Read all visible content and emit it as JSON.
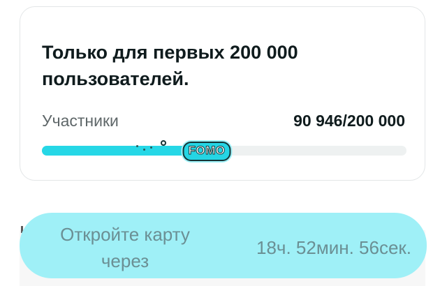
{
  "offer_card": {
    "title": "Только для первых 200 000 пользователей.",
    "participants_label": "Участники",
    "participants_count": "90 946/200 000",
    "progress_fraction": 0.4547,
    "badge_text": "FOMO"
  },
  "cta": {
    "label": "Откройте карту через",
    "timer": "18ч. 52мин. 56сек."
  },
  "colors": {
    "accent": "#26d7e6",
    "cta_background": "#9ff0f7",
    "cta_text": "#6b8f94",
    "track": "#eef1f1"
  }
}
